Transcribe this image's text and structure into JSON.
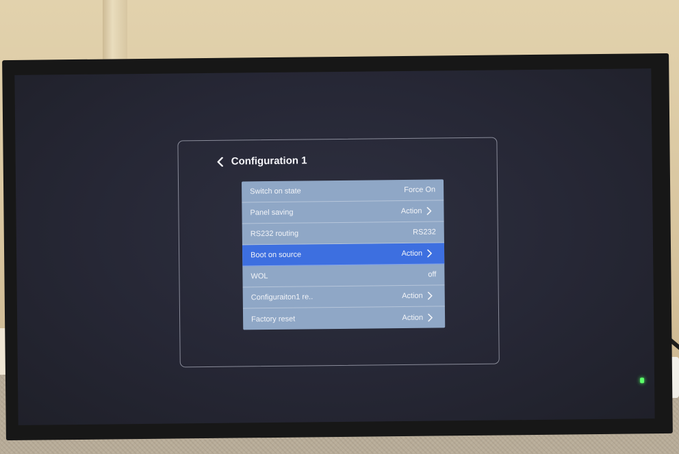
{
  "osd": {
    "title": "Configuration 1",
    "items": [
      {
        "label": "Switch on state",
        "value": "Force On",
        "chevron": false,
        "selected": false
      },
      {
        "label": "Panel saving",
        "value": "Action",
        "chevron": true,
        "selected": false
      },
      {
        "label": "RS232 routing",
        "value": "RS232",
        "chevron": false,
        "selected": false
      },
      {
        "label": "Boot on source",
        "value": "Action",
        "chevron": true,
        "selected": true
      },
      {
        "label": "WOL",
        "value": "off",
        "chevron": false,
        "selected": false
      },
      {
        "label": "Configuraiton1 re..",
        "value": "Action",
        "chevron": true,
        "selected": false
      },
      {
        "label": "Factory reset",
        "value": "Action",
        "chevron": true,
        "selected": false
      }
    ]
  },
  "colors": {
    "menu_bg": "#8fa7c6",
    "selected_bg": "#3d6fe0",
    "screen_bg": "#262735",
    "power_led": "#5cff6a"
  },
  "icons": {
    "back": "chevron-left-icon",
    "submenu": "chevron-right-icon"
  }
}
